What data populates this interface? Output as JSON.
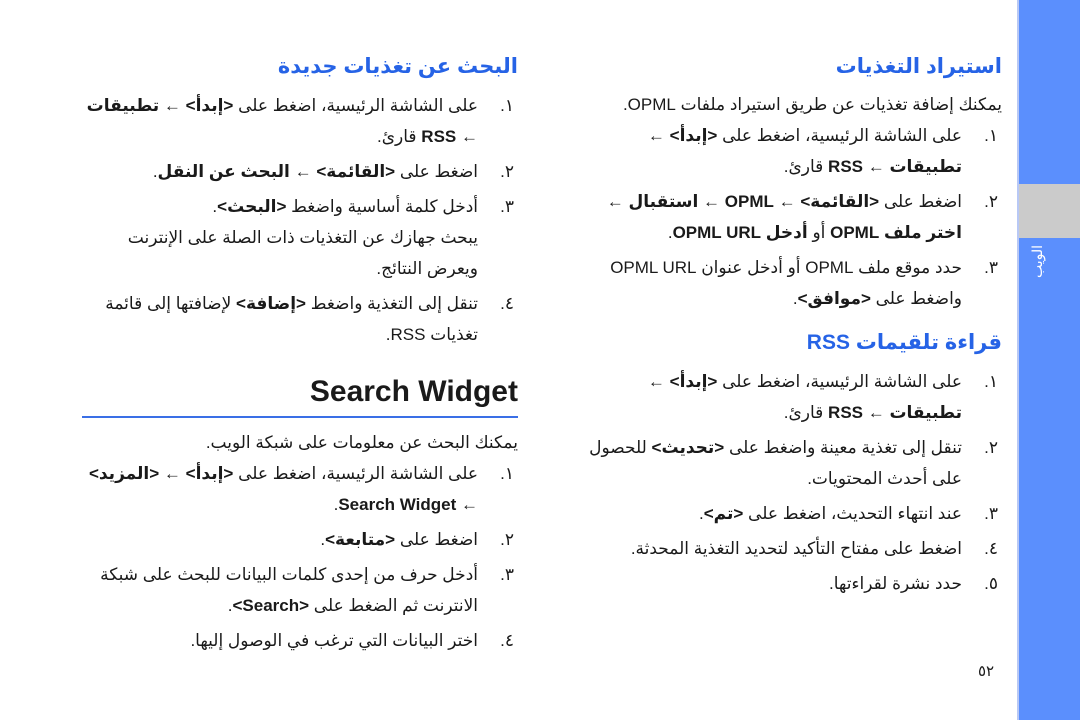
{
  "sidebar": {
    "label": "الويب"
  },
  "right": {
    "section1": {
      "title": "استيراد التغذيات",
      "intro": "يمكنك إضافة تغذيات عن طريق استيراد ملفات OPML.",
      "steps": [
        {
          "num": "١.",
          "html": "على الشاشة الرئيسية، اضغط على <b>&lt;إبدأ&gt;</b> ← <b>تطبيقات</b> ← <b>RSS</b> قارئ."
        },
        {
          "num": "٢.",
          "html": "اضغط على <b>&lt;القائمة&gt;</b> ← <b>OPML</b> ← <b>استقبال</b> ← <b>اختر ملف OPML</b> أو <b>أدخل OPML URL</b>."
        },
        {
          "num": "٣.",
          "html": "حدد موقع ملف OPML أو أدخل عنوان OPML URL واضغط على <b>&lt;موافق&gt;</b>."
        }
      ]
    },
    "section2": {
      "title": "قراءة تلقيمات RSS",
      "steps": [
        {
          "num": "١.",
          "html": "على الشاشة الرئيسية، اضغط على <b>&lt;إبدأ&gt;</b> ← <b>تطبيقات</b> ← <b>RSS</b> قارئ."
        },
        {
          "num": "٢.",
          "html": "تنقل إلى تغذية معينة واضغط على <b>&lt;تحديث&gt;</b> للحصول على أحدث المحتويات."
        },
        {
          "num": "٣.",
          "html": "عند انتهاء التحديث، اضغط على <b>&lt;تم&gt;</b>."
        },
        {
          "num": "٤.",
          "html": "اضغط على مفتاح التأكيد لتحديد التغذية المحدثة."
        },
        {
          "num": "٥.",
          "html": "حدد نشرة لقراءتها."
        }
      ]
    }
  },
  "left": {
    "section1": {
      "title": "البحث عن تغذيات جديدة",
      "steps": [
        {
          "num": "١.",
          "html": "على الشاشة الرئيسية، اضغط على <b>&lt;إبدأ&gt;</b> ← <b>تطبيقات</b> ← <b>RSS</b> قارئ."
        },
        {
          "num": "٢.",
          "html": "اضغط على <b>&lt;القائمة&gt;</b> ← <b>البحث عن النقل</b>."
        },
        {
          "num": "٣.",
          "html": "أدخل كلمة أساسية واضغط <b>&lt;البحث&gt;</b>.<br>يبحث جهازك عن التغذيات ذات الصلة على الإنترنت ويعرض النتائج."
        },
        {
          "num": "٤.",
          "html": "تنقل إلى التغذية واضغط <b>&lt;إضافة&gt;</b> لإضافتها إلى قائمة تغذيات RSS."
        }
      ]
    },
    "section2": {
      "title": "Search Widget",
      "intro": "يمكنك البحث عن معلومات على شبكة الويب.",
      "steps": [
        {
          "num": "١.",
          "html": "على الشاشة الرئيسية، اضغط على <b>&lt;إبدأ&gt;</b> ← <b>&lt;المزيد&gt;</b> ← <b>Search Widget</b>."
        },
        {
          "num": "٢.",
          "html": "اضغط على <b>&lt;متابعة&gt;</b>."
        },
        {
          "num": "٣.",
          "html": "أدخل حرف من إحدى كلمات البيانات للبحث على شبكة الانترنت ثم الضغط على <b>&lt;Search&gt;</b>."
        },
        {
          "num": "٤.",
          "html": "اختر البيانات التي ترغب في الوصول إليها."
        }
      ]
    }
  },
  "page_number": "٥٢"
}
